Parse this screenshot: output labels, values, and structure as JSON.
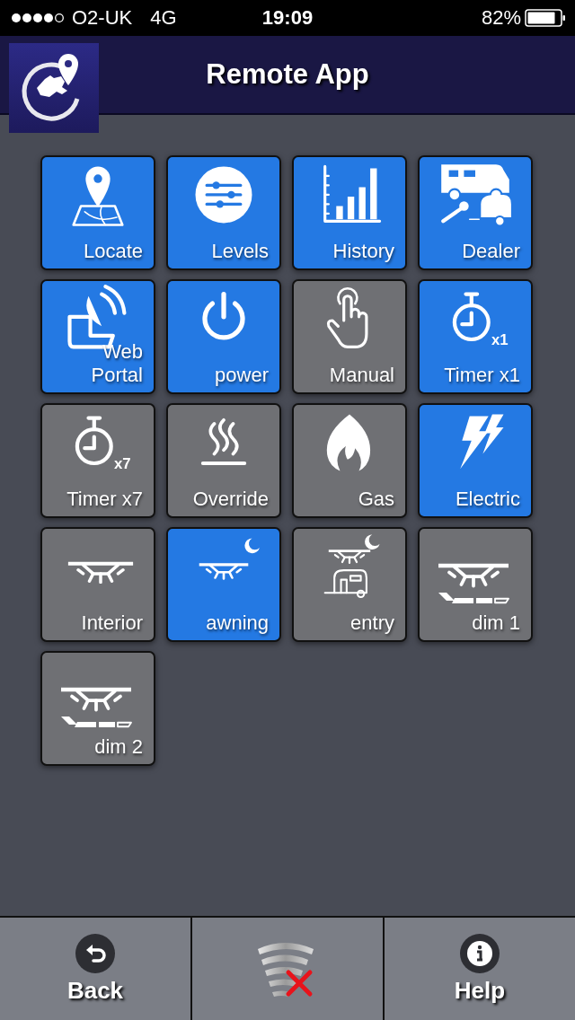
{
  "status_bar": {
    "carrier": "O2-UK",
    "network": "4G",
    "time": "19:09",
    "battery": "82%"
  },
  "header": {
    "title": "Remote App"
  },
  "tiles": [
    {
      "label": "Locate",
      "on": true,
      "kind": "locate"
    },
    {
      "label": "Levels",
      "on": true,
      "kind": "levels"
    },
    {
      "label": "History",
      "on": true,
      "kind": "history"
    },
    {
      "label": "Dealer",
      "on": true,
      "kind": "dealer"
    },
    {
      "label": "Web Portal",
      "on": true,
      "kind": "portal"
    },
    {
      "label": "power",
      "on": true,
      "kind": "power"
    },
    {
      "label": "Manual",
      "on": false,
      "kind": "manual"
    },
    {
      "label": "Timer x1",
      "on": true,
      "kind": "timer",
      "badge": "x1"
    },
    {
      "label": "Timer x7",
      "on": false,
      "kind": "timer",
      "badge": "x7"
    },
    {
      "label": "Override",
      "on": false,
      "kind": "override"
    },
    {
      "label": "Gas",
      "on": false,
      "kind": "gas"
    },
    {
      "label": "Electric",
      "on": true,
      "kind": "electric"
    },
    {
      "label": "Interior",
      "on": false,
      "kind": "light"
    },
    {
      "label": "awning",
      "on": true,
      "kind": "awning"
    },
    {
      "label": "entry",
      "on": false,
      "kind": "entry"
    },
    {
      "label": "dim 1",
      "on": false,
      "kind": "dim"
    },
    {
      "label": "dim 2",
      "on": false,
      "kind": "dim"
    }
  ],
  "bottom_bar": [
    {
      "kind": "back",
      "label": "Back"
    },
    {
      "kind": "connection"
    },
    {
      "kind": "help",
      "label": "Help"
    }
  ]
}
